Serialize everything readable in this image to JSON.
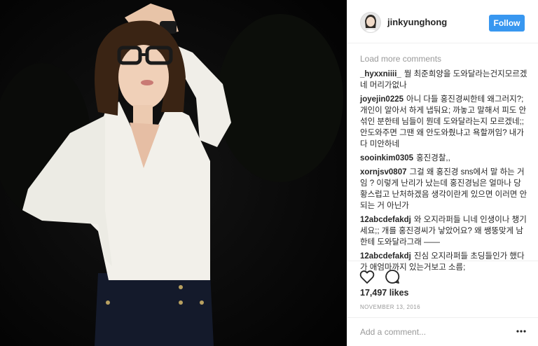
{
  "post": {
    "photo_icon": "post-photo",
    "username": "jinkyunghong",
    "follow_label": "Follow",
    "accent_color": "#3897f0"
  },
  "comments_section": {
    "load_more": "Load more comments",
    "items": [
      {
        "author": "_hyxxniiii_",
        "text": "뭘 최준희양을 도와달라는건지모르겠네 머리가없나"
      },
      {
        "author": "joyejin0225",
        "text": "아니 다들 홍진경씨한테 왜그러지?; 개인이 알아서 하게 냅둬요; 까놓고 말해서 피도 안섞인 분한테 님들이 뭔데 도와달라는지 모르겠네;; 안도와주면 그땐 왜 안도와줬냐고 욕할꺼임? 내가 다 미안하네"
      },
      {
        "author": "sooinkim0305",
        "text": "홍진경찰,,"
      },
      {
        "author": "xornjsv0807",
        "text": "그걸 왜 홍진경 sns에서 말 하는 거임 ? 이렇게 난리가 났는데 홍진경님은 얼마나 당황스럽고 난처하겠음 생각이란게 있으면 이러면 안 되는 거 아닌가"
      },
      {
        "author": "12abcdefakdj",
        "text": "와 오지라퍼들 니네 인생이나 챙기세요;; 개를 홍진경씨가 낳았어요? 왜 쌩뚱맞게 남한테 도와달라그래 ——"
      },
      {
        "author": "12abcdefakdj",
        "text": "진심 오지라퍼들 초딩들인가 했다가 애엄마까지 있는거보고 소름;"
      }
    ]
  },
  "actions": {
    "like_icon": "heart-icon",
    "comment_icon": "comment-bubble-icon",
    "likes": "17,497 likes",
    "date": "NOVEMBER 13, 2016",
    "add_comment_placeholder": "Add a comment...",
    "more_icon": "ellipsis-icon"
  }
}
